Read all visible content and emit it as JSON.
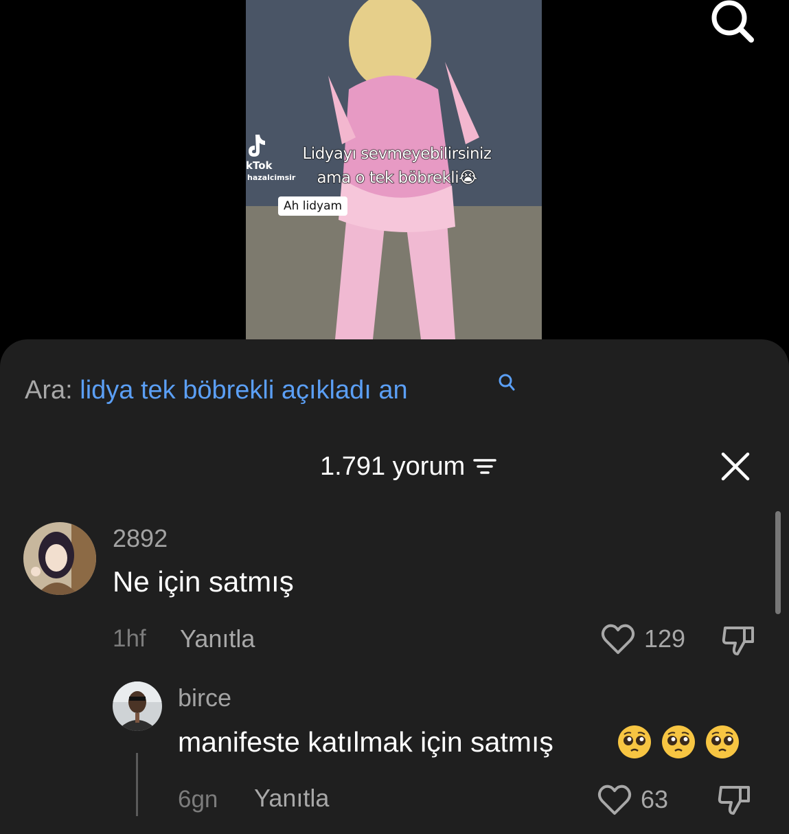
{
  "video": {
    "overlay_line1": "Lidyayı sevmeyebilirsiniz",
    "overlay_line2": "ama o tek böbrekli😭",
    "brand": "kTok",
    "username": "hazalcimsir",
    "sticker": "Ah lidyam"
  },
  "search_suggestion": {
    "prefix": "Ara:",
    "query": "lidya tek böbrekli açıkladı an"
  },
  "comments_header": {
    "count_label": "1.791 yorum"
  },
  "comments": [
    {
      "username": "2892",
      "text": "Ne için satmış",
      "time": "1hf",
      "reply_label": "Yanıtla",
      "likes": "129"
    },
    {
      "username": "birce",
      "text": "manifeste katılmak için satmış",
      "emojis": [
        "pleading-face",
        "pleading-face",
        "pleading-face"
      ],
      "time": "6gn",
      "reply_label": "Yanıtla",
      "likes": "63"
    }
  ],
  "colors": {
    "sheet_bg": "#1f1f1f",
    "link_blue": "#5b9ff5",
    "muted_text": "#a8a8a8"
  }
}
